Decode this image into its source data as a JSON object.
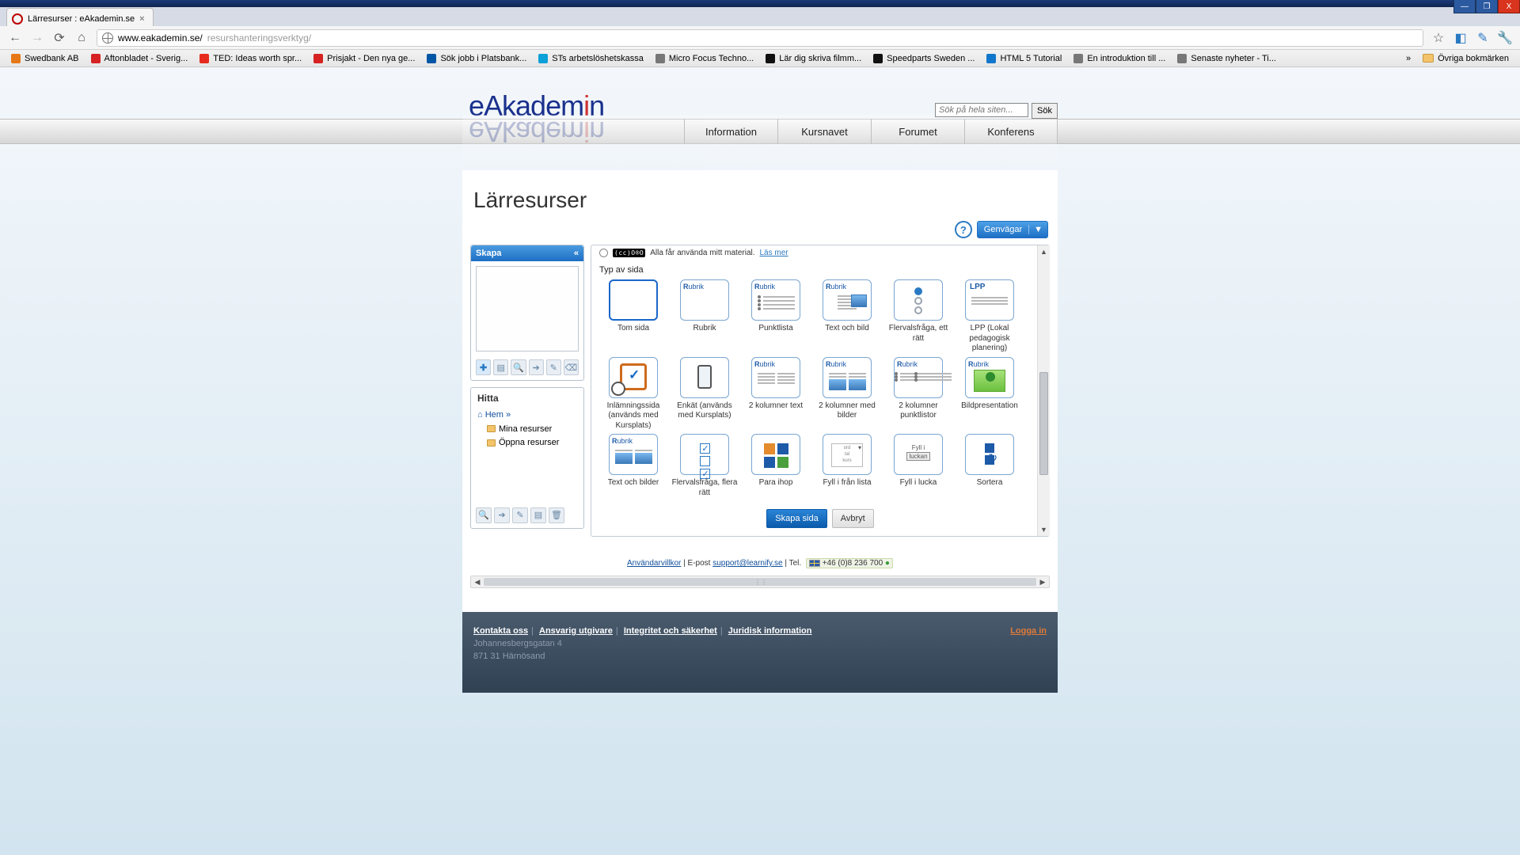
{
  "window": {
    "tab_title": "Lärresurser : eAkademin.se",
    "url_host": "www.eakademin.se/",
    "url_path": "resurshanteringsverktyg/"
  },
  "bookmarks": [
    {
      "label": "Swedbank AB",
      "color": "#e67817"
    },
    {
      "label": "Aftonbladet - Sverig...",
      "color": "#d62222"
    },
    {
      "label": "TED: Ideas worth spr...",
      "color": "#e62b1e"
    },
    {
      "label": "Prisjakt - Den nya ge...",
      "color": "#d62222"
    },
    {
      "label": "Sök jobb i Platsbank...",
      "color": "#0055a5"
    },
    {
      "label": "STs arbetslöshetskassa",
      "color": "#0aa0d8"
    },
    {
      "label": "Micro Focus Techno...",
      "color": "#777"
    },
    {
      "label": "Lär dig skriva filmm...",
      "color": "#111"
    },
    {
      "label": "Speedparts Sweden ...",
      "color": "#111"
    },
    {
      "label": "HTML 5 Tutorial",
      "color": "#1177cc"
    },
    {
      "label": "En introduktion till ...",
      "color": "#777"
    },
    {
      "label": "Senaste nyheter - Ti...",
      "color": "#777"
    }
  ],
  "bookmarks_overflow": "»",
  "bookmarks_other": "Övriga bokmärken",
  "site": {
    "logo_a": "eAkadem",
    "logo_b": "i",
    "logo_c": "n",
    "search_placeholder": "Sök på hela siten...",
    "search_btn": "Sök",
    "nav": [
      "Information",
      "Kursnavet",
      "Forumet",
      "Konferens"
    ]
  },
  "page": {
    "title": "Lärresurser",
    "shortcuts": "Genvägar"
  },
  "panel_create": {
    "title": "Skapa"
  },
  "panel_find": {
    "title": "Hitta",
    "home": "Hem »",
    "items": [
      "Mina resurser",
      "Öppna resurser"
    ]
  },
  "workspace": {
    "cc_text": "Alla får använda mitt material.",
    "cc_more": "Läs mer",
    "section": "Typ av sida",
    "tiles": [
      {
        "label": "Tom sida"
      },
      {
        "label": "Rubrik"
      },
      {
        "label": "Punktlista"
      },
      {
        "label": "Text och bild"
      },
      {
        "label": "Flervalsfråga, ett rätt"
      },
      {
        "label": "LPP (Lokal pedagogisk planering)"
      },
      {
        "label": "Inlämningssida (används med Kursplats)"
      },
      {
        "label": "Enkät (används med Kursplats)"
      },
      {
        "label": "2 kolumner text"
      },
      {
        "label": "2 kolumner med bilder"
      },
      {
        "label": "2 kolumner punktlistor"
      },
      {
        "label": "Bildpresentation"
      },
      {
        "label": "Text och bilder"
      },
      {
        "label": "Flervalsfråga, flera rätt"
      },
      {
        "label": "Para ihop"
      },
      {
        "label": "Fyll i från lista"
      },
      {
        "label": "Fyll i lucka"
      },
      {
        "label": "Sortera"
      }
    ],
    "rubric_word": "Rubrik",
    "cloze_top": "Fyll i",
    "cloze_box": "luckan",
    "list_words": "ord\ntal\nkurs",
    "create_btn": "Skapa sida",
    "cancel_btn": "Avbryt"
  },
  "footer_line": {
    "terms": "Användarvillkor",
    "email_lbl": "E-post",
    "email": "support@learnify.se",
    "tel_lbl": "Tel.",
    "tel": "+46 (0)8 236 700"
  },
  "sitefooter": {
    "links": [
      "Kontakta oss",
      "Ansvarig utgivare",
      "Integritet och säkerhet",
      "Juridisk information"
    ],
    "addr1": "Johannesbergsgatan 4",
    "addr2": "871 31 Härnösand",
    "login": "Logga in"
  }
}
